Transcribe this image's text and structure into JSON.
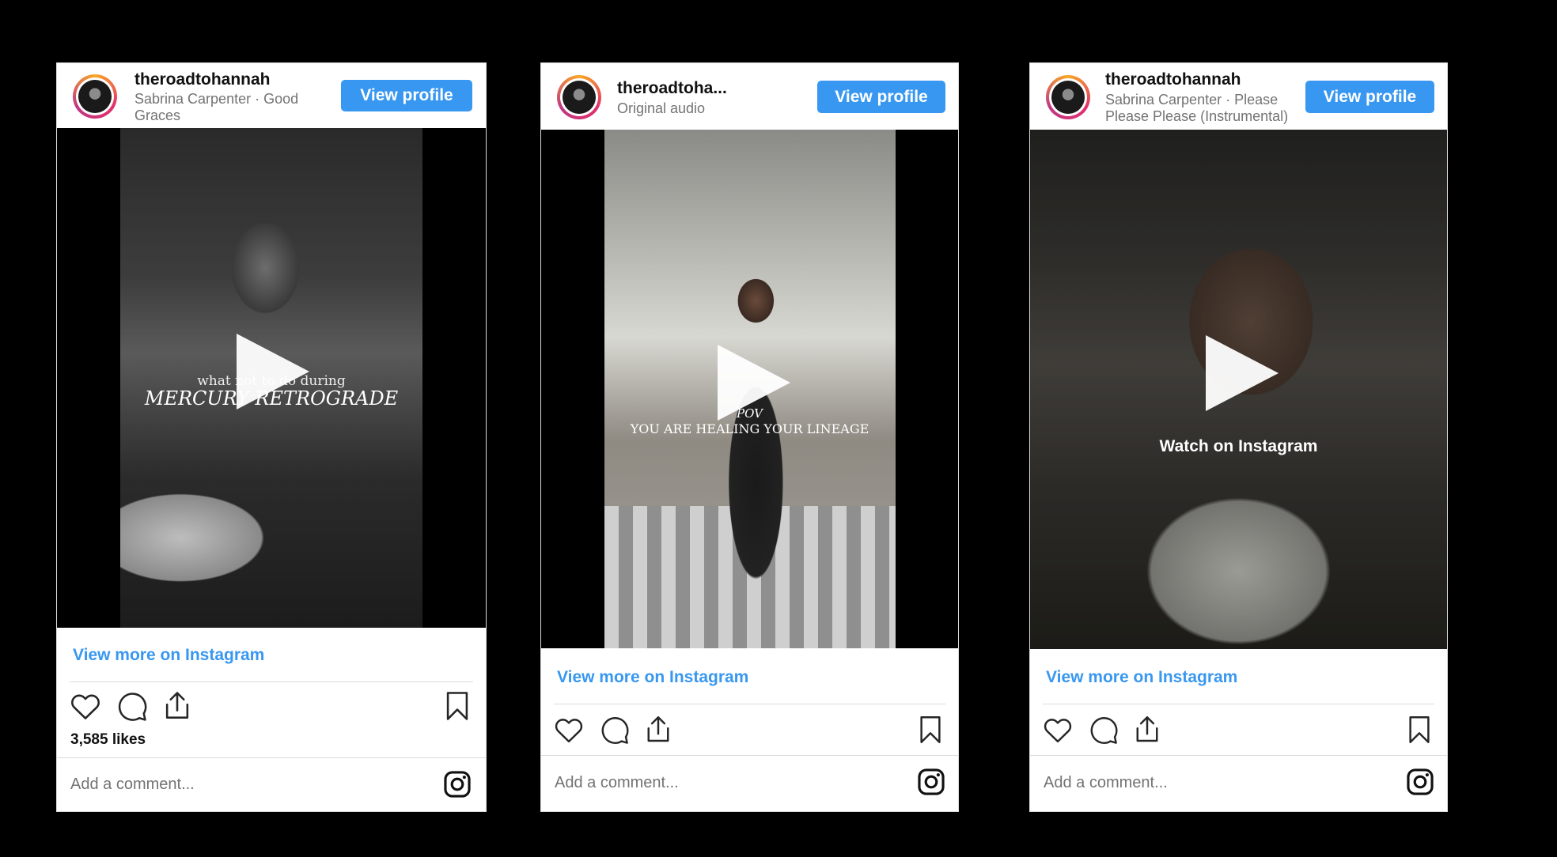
{
  "cards": [
    {
      "username": "theroadtohannah",
      "audio": "Sabrina Carpenter · Good Graces",
      "view_profile": "View profile",
      "overlay_small": "what not to do during",
      "overlay_large": "MERCURY RETROGRADE",
      "view_more": "View more on Instagram",
      "likes": "3,585 likes",
      "comment_placeholder": "Add a comment..."
    },
    {
      "username": "theroadtoha...",
      "audio": "Original audio",
      "view_profile": "View profile",
      "overlay_small": "POV",
      "overlay_large": "YOU ARE HEALING YOUR LINEAGE",
      "view_more": "View more on Instagram",
      "comment_placeholder": "Add a comment..."
    },
    {
      "username": "theroadtohannah",
      "audio": "Sabrina Carpenter · Please Please Please (Instrumental)",
      "view_profile": "View profile",
      "watch_label": "Watch on Instagram",
      "view_more": "View more on Instagram",
      "comment_placeholder": "Add a comment..."
    }
  ],
  "colors": {
    "accent": "#3897f0",
    "muted": "#737373"
  },
  "icons": [
    "heart-icon",
    "comment-icon",
    "share-icon",
    "bookmark-icon",
    "instagram-icon",
    "play-icon",
    "avatar"
  ]
}
